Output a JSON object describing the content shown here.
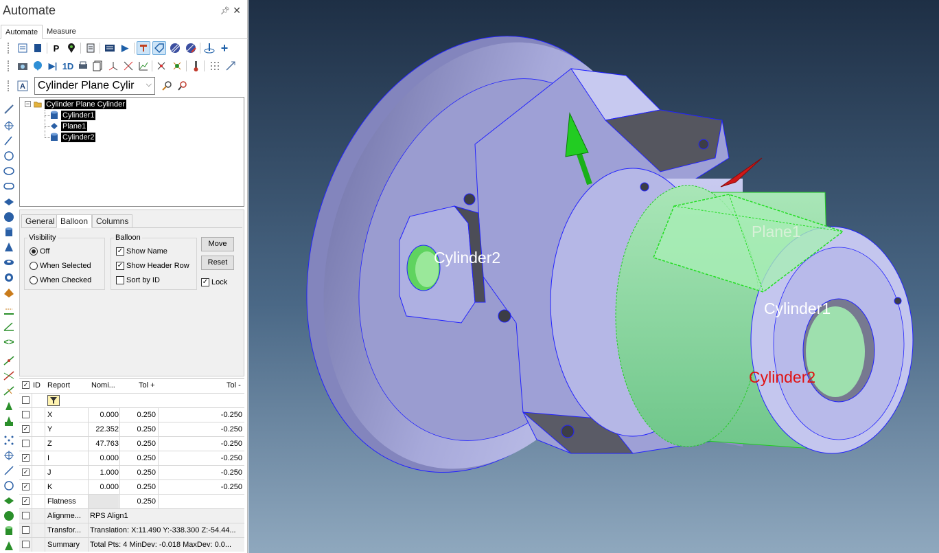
{
  "panel": {
    "title": "Automate",
    "pin_icon": "pin-icon",
    "close_icon": "close-icon",
    "tabs": [
      {
        "label": "Automate",
        "active": true
      },
      {
        "label": "Measure",
        "active": false
      }
    ]
  },
  "toolbar": {
    "row1_icons": [
      "report-template-icon",
      "book-icon",
      "p-icon",
      "feature-pick-icon",
      "document-icon",
      "list-icon",
      "play-icon",
      "auto-feature-icon",
      "tag-icon",
      "hatch-icon",
      "hatch-edit-icon",
      "probe-icon",
      "plus-icon"
    ],
    "row1_text": [
      "P",
      "▶",
      "+"
    ],
    "row2_icons": [
      "camera-icon",
      "balloon-icon",
      "step-forward-icon",
      "1d-icon",
      "printer-icon",
      "document-stack-icon",
      "axis-icon",
      "axis-alt-icon",
      "graph-icon",
      "scatter-icon",
      "target-icon",
      "thermometer-icon",
      "grid-dots-icon",
      "diagonal-icon"
    ],
    "row2_text": [
      "▶|",
      "1D"
    ],
    "combo_value": "Cylinder Plane Cylir",
    "combo_icon": "text-style-icon",
    "search_icon": "magnifier-icon",
    "settings_icon": "probe-settings-icon"
  },
  "tree": {
    "root": {
      "label": "Cylinder Plane Cylinder",
      "icon": "folder-icon"
    },
    "children": [
      {
        "label": "Cylinder1",
        "icon": "cylinder-icon"
      },
      {
        "label": "Plane1",
        "icon": "plane-icon"
      },
      {
        "label": "Cylinder2",
        "icon": "cylinder-icon"
      }
    ]
  },
  "props": {
    "tabs": [
      {
        "label": "General",
        "active": false
      },
      {
        "label": "Balloon",
        "active": true
      },
      {
        "label": "Columns",
        "active": false
      }
    ],
    "visibility": {
      "legend": "Visibility",
      "options": [
        {
          "label": "Off",
          "selected": true
        },
        {
          "label": "When Selected",
          "selected": false
        },
        {
          "label": "When Checked",
          "selected": false
        }
      ]
    },
    "balloon": {
      "legend": "Balloon",
      "options": [
        {
          "label": "Show Name",
          "checked": true
        },
        {
          "label": "Show Header Row",
          "checked": true
        },
        {
          "label": "Sort by ID",
          "checked": false
        }
      ]
    },
    "move_label": "Move",
    "reset_label": "Reset",
    "lock_label": "Lock",
    "lock_checked": true
  },
  "grid": {
    "headers": [
      "ID",
      "Report",
      "Nomi...",
      "Tol +",
      "Tol -"
    ],
    "header_checked": true,
    "rows": [
      {
        "checked": false,
        "report": "X",
        "nominal": "0.000",
        "tol_plus": "0.250",
        "tol_minus": "-0.250"
      },
      {
        "checked": true,
        "report": "Y",
        "nominal": "22.352",
        "tol_plus": "0.250",
        "tol_minus": "-0.250"
      },
      {
        "checked": false,
        "report": "Z",
        "nominal": "47.763",
        "tol_plus": "0.250",
        "tol_minus": "-0.250"
      },
      {
        "checked": true,
        "report": "I",
        "nominal": "0.000",
        "tol_plus": "0.250",
        "tol_minus": "-0.250"
      },
      {
        "checked": true,
        "report": "J",
        "nominal": "1.000",
        "tol_plus": "0.250",
        "tol_minus": "-0.250"
      },
      {
        "checked": true,
        "report": "K",
        "nominal": "0.000",
        "tol_plus": "0.250",
        "tol_minus": "-0.250"
      },
      {
        "checked": true,
        "report": "Flatness",
        "nominal": "",
        "tol_plus": "0.250",
        "tol_minus": ""
      },
      {
        "checked": false,
        "report": "Alignme...",
        "wide": "RPS Align1"
      },
      {
        "checked": false,
        "report": "Transfor...",
        "wide": "Translation: X:11.490 Y:-338.300 Z:-54.44..."
      },
      {
        "checked": false,
        "report": "Summary",
        "wide": "Total Pts: 4  MinDev: -0.018  MaxDev: 0.0..."
      }
    ]
  },
  "viewport": {
    "labels": [
      {
        "text": "Plane1",
        "color": "#d8f0d8"
      },
      {
        "text": "Cylinder2",
        "color": "#ffffff"
      },
      {
        "text": "Cylinder1",
        "color": "#ffffff"
      },
      {
        "text": "Cylinder2",
        "color": "#e01010"
      }
    ],
    "colors": {
      "part": "#a4a6d6",
      "highlight": "#7fd39a",
      "edge": "#1a1aff"
    }
  }
}
